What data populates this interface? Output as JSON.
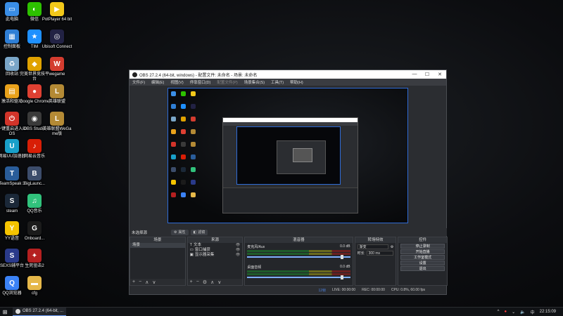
{
  "desktop": {
    "icons": [
      {
        "label": "此电脑",
        "icon": "computer-icon",
        "color": "#3a8ee6",
        "glyph": "▭"
      },
      {
        "label": "微信",
        "icon": "wechat-icon",
        "color": "#2dc100",
        "glyph": "◐"
      },
      {
        "label": "PotPlayer 64 bit",
        "icon": "potplayer-icon",
        "color": "#f2c81a",
        "glyph": "▶"
      },
      {
        "label": "控制面板",
        "icon": "control-panel-icon",
        "color": "#2f7fd6",
        "glyph": "▦"
      },
      {
        "label": "TIM",
        "icon": "tim-icon",
        "color": "#1e90ff",
        "glyph": "★"
      },
      {
        "label": "Ubisoft Connect",
        "icon": "ubisoft-icon",
        "color": "#222244",
        "glyph": "◎"
      },
      {
        "label": "回收站",
        "icon": "recycle-bin-icon",
        "color": "#7aa6c8",
        "glyph": "♻"
      },
      {
        "label": "完美世界竞技平台",
        "icon": "perfect-world-icon",
        "color": "#e0a200",
        "glyph": "◆"
      },
      {
        "label": "wegame",
        "icon": "wegame-icon",
        "color": "#d43c2f",
        "glyph": "W"
      },
      {
        "label": "激活和驱动",
        "icon": "driver-icon",
        "color": "#e9a21b",
        "glyph": "▤"
      },
      {
        "label": "Google Chrome",
        "icon": "chrome-icon",
        "color": "#de4032",
        "glyph": "●"
      },
      {
        "label": "英雄联盟",
        "icon": "lol-icon",
        "color": "#b48a35",
        "glyph": "L"
      },
      {
        "label": "一键重启进入BIOS",
        "icon": "bios-icon",
        "color": "#d2342a",
        "glyph": "⏻"
      },
      {
        "label": "OBS Studio",
        "icon": "obs-icon",
        "color": "#3a3a3a",
        "glyph": "◉"
      },
      {
        "label": "英雄联盟WeGame版",
        "icon": "lol-wegame-icon",
        "color": "#b48a35",
        "glyph": "L"
      },
      {
        "label": "网易UU加速器",
        "icon": "uu-icon",
        "color": "#19a0c9",
        "glyph": "U"
      },
      {
        "label": "网易云音乐",
        "icon": "netease-music-icon",
        "color": "#d81e06",
        "glyph": "♪"
      },
      {
        "label": "TeamSpeak 3",
        "icon": "teamspeak-icon",
        "color": "#2a5d9a",
        "glyph": "T"
      },
      {
        "label": "BigLaunc...",
        "icon": "biglauncher-icon",
        "color": "#3c4d6b",
        "glyph": "B"
      },
      {
        "label": "steam",
        "icon": "steam-icon",
        "color": "#1b2838",
        "glyph": "S"
      },
      {
        "label": "QQ音乐",
        "icon": "qq-music-icon",
        "color": "#31c27c",
        "glyph": "♫"
      },
      {
        "label": "YY语音",
        "icon": "yy-icon",
        "color": "#f5c400",
        "glyph": "Y"
      },
      {
        "label": "Onboard...",
        "icon": "onboard-icon",
        "color": "#1b1b1b",
        "glyph": "G"
      },
      {
        "label": "SEXS辅平台",
        "icon": "sexs-icon",
        "color": "#2a3a8a",
        "glyph": "S"
      },
      {
        "label": "生死狙击2",
        "icon": "game-icon",
        "color": "#b52020",
        "glyph": "✦"
      },
      {
        "label": "QQ浏览器",
        "icon": "qq-browser-icon",
        "color": "#3b82f6",
        "glyph": "Q"
      },
      {
        "label": "cfg",
        "icon": "folder-icon",
        "color": "#e6b84a",
        "glyph": "▬"
      }
    ]
  },
  "obs": {
    "title": "OBS 27.2.4 (64-bit, windows) - 配置文件: 未命名 - 场景: 未命名",
    "window_buttons": [
      "—",
      "☐",
      "✕"
    ],
    "menu": [
      "文件(F)",
      "编辑(E)",
      "视图(V)",
      "停靠窗口(D)",
      "配置文件(P)",
      "场景集合(S)",
      "工具(T)",
      "帮助(H)"
    ],
    "source_strip": {
      "label": "未选择源",
      "properties": "属性",
      "filters": "滤镜"
    },
    "scenes": {
      "title": "场景",
      "items": [
        "场景"
      ]
    },
    "sources": {
      "title": "来源",
      "items": [
        "文本",
        "窗口捕获",
        "显示器采集"
      ]
    },
    "mixer": {
      "title": "混音器",
      "channels": [
        {
          "name": "麦克风/Aux",
          "db": "0.0 dB"
        },
        {
          "name": "桌面音频",
          "db": "0.0 dB"
        }
      ]
    },
    "transitions": {
      "title": "转场特效",
      "type": "渐变",
      "duration_label": "时长",
      "duration": "300 ms"
    },
    "controls": {
      "title": "控件",
      "buttons": [
        "停止录制",
        "开始直播",
        "工作室模式",
        "设置",
        "退出"
      ]
    },
    "status": {
      "live_label": "LIVE:",
      "live_time": "00:00:00",
      "rec_label": "REC:",
      "rec_time": "00:00:00",
      "cpu": "CPU: 0.8%, 60.00 fps",
      "dropped": "12帧"
    }
  },
  "taskbar": {
    "start": "⊞",
    "task": "OBS 27.2.4 (64-bit, ...",
    "tray": {
      "caret": "^",
      "chevron": "⌄",
      "speaker": "🔈",
      "ime": "中",
      "time": "22:15:09"
    }
  }
}
